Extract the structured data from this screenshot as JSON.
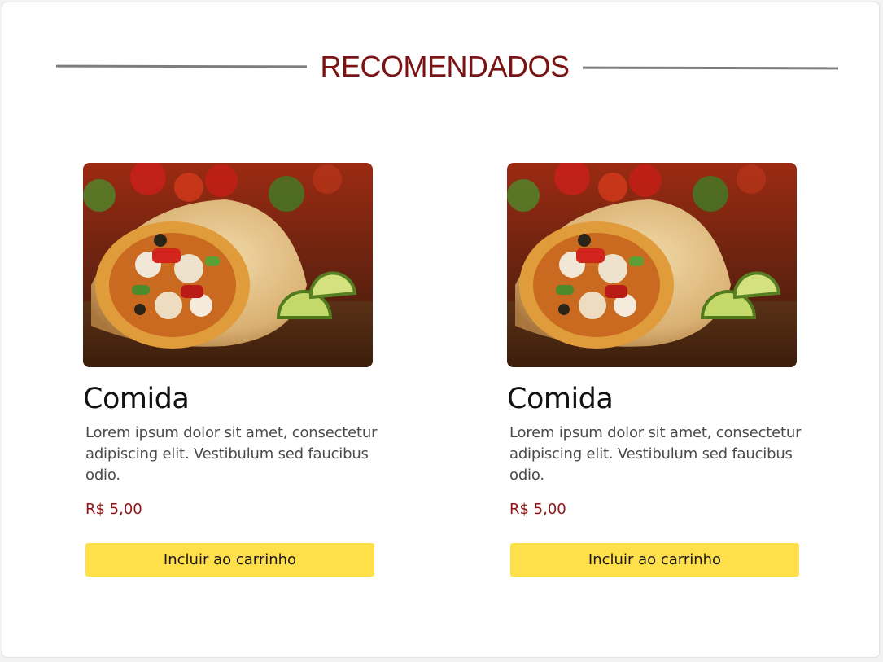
{
  "section": {
    "title": "RECOMENDADOS"
  },
  "products": [
    {
      "image_icon": "burrito-photo",
      "name": "Comida",
      "description": "Lorem ipsum dolor sit amet, consectetur adipiscing elit. Vestibulum sed faucibus odio.",
      "price": "R$ 5,00",
      "button_label": "Incluir ao carrinho"
    },
    {
      "image_icon": "burrito-photo",
      "name": "Comida",
      "description": "Lorem ipsum dolor sit amet, consectetur adipiscing elit. Vestibulum sed faucibus odio.",
      "price": "R$ 5,00",
      "button_label": "Incluir ao carrinho"
    }
  ],
  "colors": {
    "title": "#7a1414",
    "price": "#8b1414",
    "button": "#ffe04a",
    "rule": "#7d7d7d"
  }
}
